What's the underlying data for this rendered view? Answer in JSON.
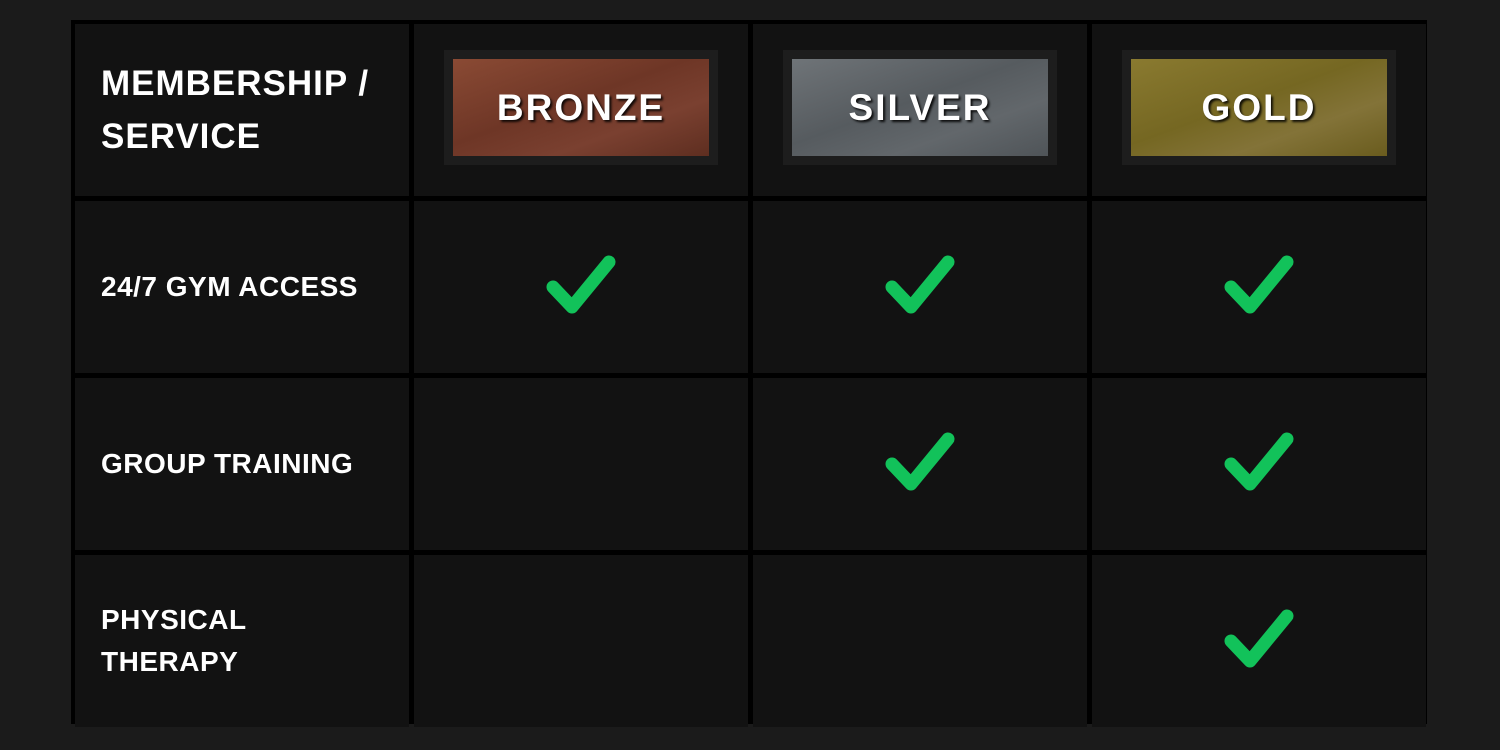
{
  "table": {
    "header_label": "MEMBERSHIP /\nSERVICE",
    "tiers": [
      {
        "name": "BRONZE"
      },
      {
        "name": "SILVER"
      },
      {
        "name": "GOLD"
      }
    ],
    "rows": [
      {
        "service": "24/7 GYM ACCESS",
        "included": [
          true,
          true,
          true
        ]
      },
      {
        "service": "GROUP TRAINING",
        "included": [
          false,
          true,
          true
        ]
      },
      {
        "service": "PHYSICAL\nTHERAPY",
        "included": [
          false,
          false,
          true
        ]
      }
    ]
  },
  "colors": {
    "background": "#1b1b1b",
    "cell": "#121212",
    "grid_lines": "#000000",
    "check": "#12c25a",
    "bronze": "#7a3f2d",
    "silver": "#5f6468",
    "gold": "#7d6e2c"
  },
  "icons": {
    "included": "checkmark-icon"
  }
}
